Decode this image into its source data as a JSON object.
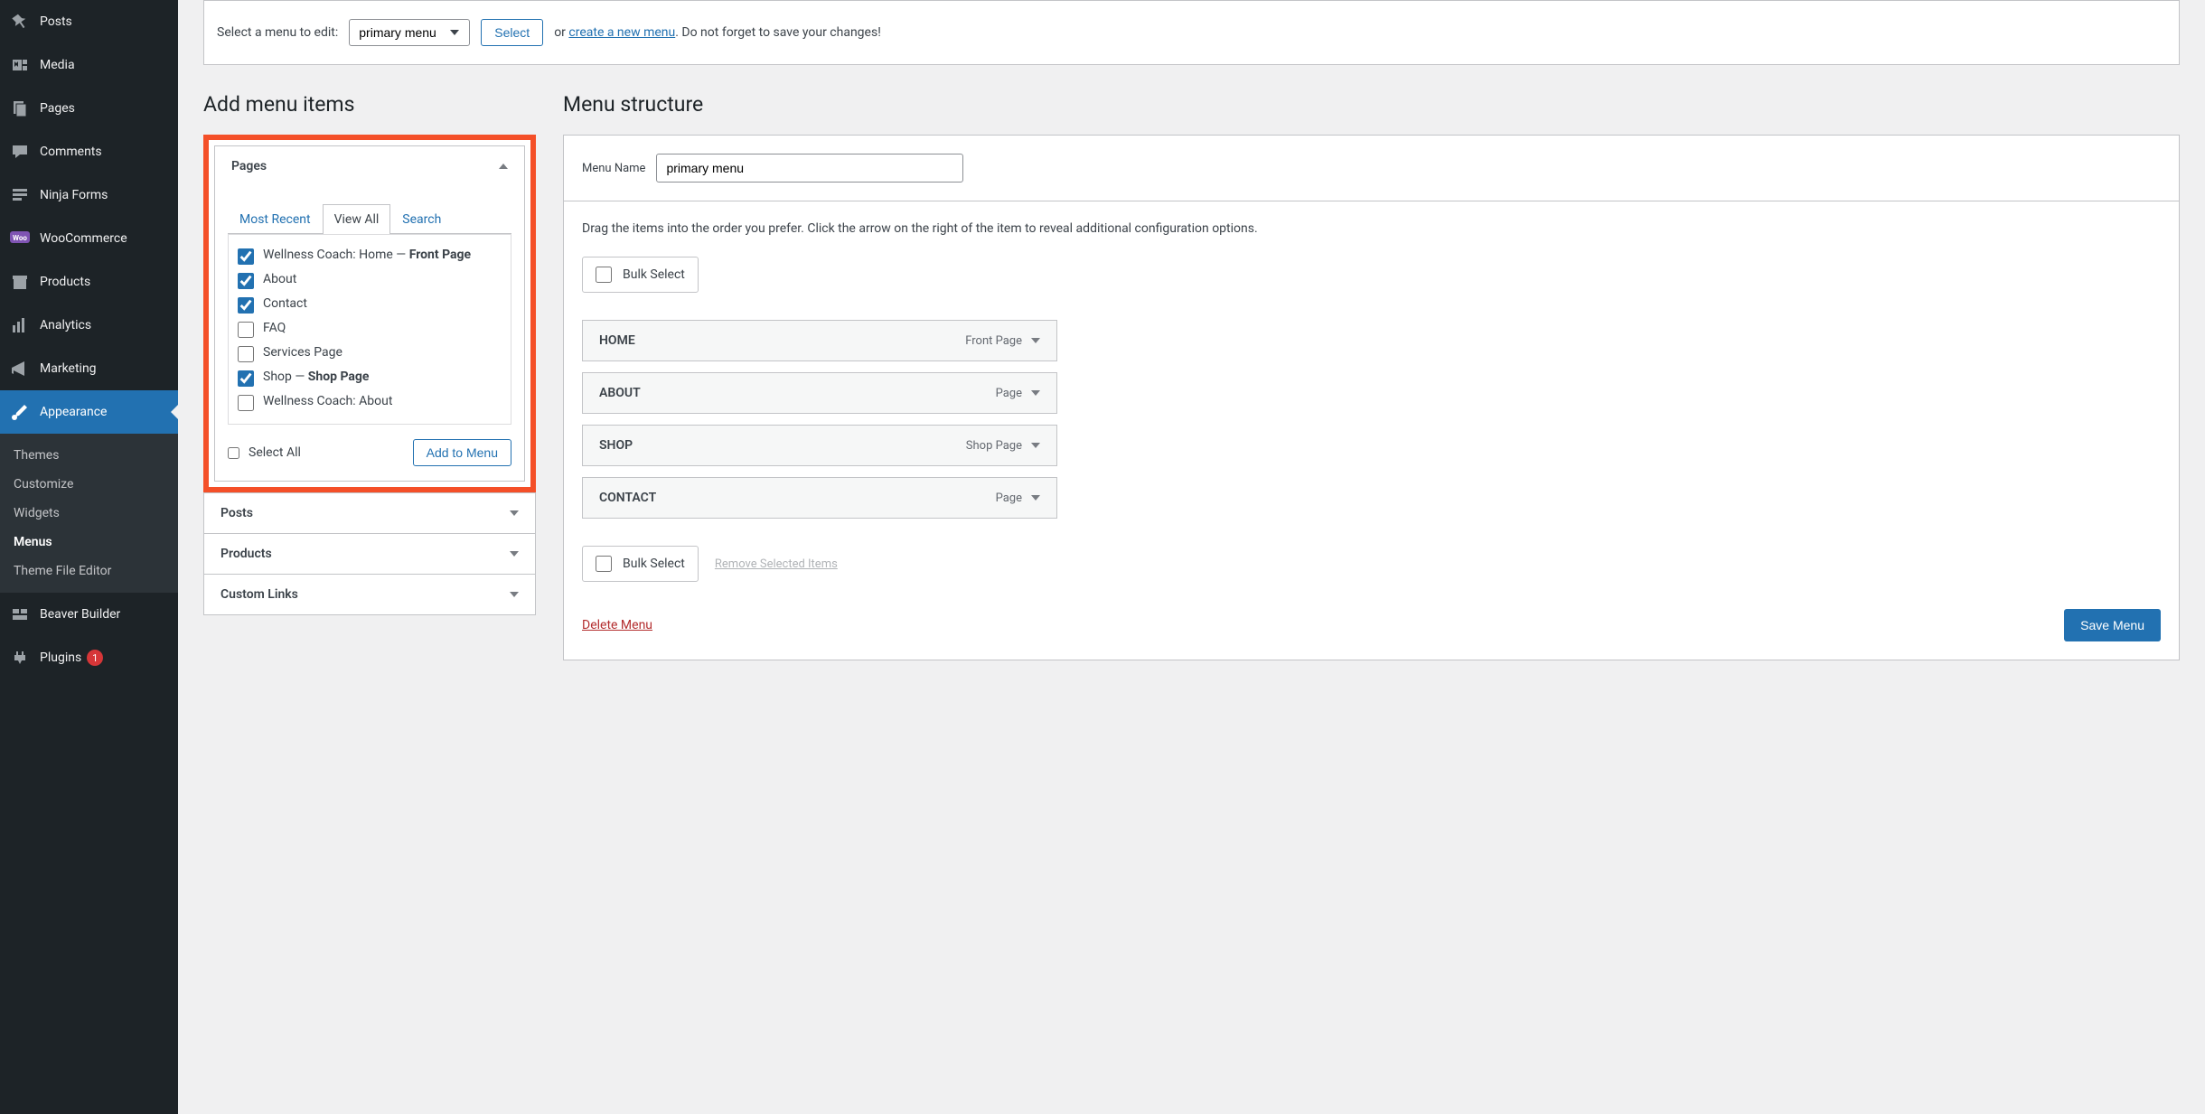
{
  "sidebar": {
    "items": [
      {
        "label": "Posts",
        "icon": "pin"
      },
      {
        "label": "Media",
        "icon": "media"
      },
      {
        "label": "Pages",
        "icon": "pages"
      },
      {
        "label": "Comments",
        "icon": "comment"
      },
      {
        "label": "Ninja Forms",
        "icon": "form"
      },
      {
        "label": "WooCommerce",
        "icon": "woo"
      },
      {
        "label": "Products",
        "icon": "products"
      },
      {
        "label": "Analytics",
        "icon": "analytics"
      },
      {
        "label": "Marketing",
        "icon": "marketing"
      },
      {
        "label": "Appearance",
        "icon": "brush"
      },
      {
        "label": "Beaver Builder",
        "icon": "beaver"
      },
      {
        "label": "Plugins",
        "icon": "plugin",
        "badge": "1"
      }
    ],
    "submenu": {
      "items": [
        {
          "label": "Themes"
        },
        {
          "label": "Customize"
        },
        {
          "label": "Widgets"
        },
        {
          "label": "Menus"
        },
        {
          "label": "Theme File Editor"
        }
      ],
      "current_index": 3
    }
  },
  "topbar": {
    "prompt": "Select a menu to edit:",
    "selected_menu": "primary menu",
    "select_btn": "Select",
    "or_text": "or ",
    "create_link": "create a new menu",
    "save_reminder": ". Do not forget to save your changes!"
  },
  "left": {
    "heading": "Add menu items",
    "accordion": {
      "expanded": "Pages",
      "tabs": [
        "Most Recent",
        "View All",
        "Search"
      ],
      "active_tab_index": 1,
      "pages": [
        {
          "checked": true,
          "label_prefix": "Wellness Coach: Home — ",
          "label_bold": "Front Page"
        },
        {
          "checked": true,
          "label_prefix": "About",
          "label_bold": ""
        },
        {
          "checked": true,
          "label_prefix": "Contact",
          "label_bold": ""
        },
        {
          "checked": false,
          "label_prefix": "FAQ",
          "label_bold": ""
        },
        {
          "checked": false,
          "label_prefix": "Services Page",
          "label_bold": ""
        },
        {
          "checked": true,
          "label_prefix": "Shop — ",
          "label_bold": "Shop Page"
        },
        {
          "checked": false,
          "label_prefix": "Wellness Coach: About",
          "label_bold": ""
        }
      ],
      "select_all": "Select All",
      "add_btn": "Add to Menu",
      "collapsed": [
        "Posts",
        "Products",
        "Custom Links"
      ]
    }
  },
  "right": {
    "heading": "Menu structure",
    "menu_name_label": "Menu Name",
    "menu_name_value": "primary menu",
    "desc": "Drag the items into the order you prefer. Click the arrow on the right of the item to reveal additional configuration options.",
    "bulk_select": "Bulk Select",
    "menu_items": [
      {
        "title": "HOME",
        "type": "Front Page"
      },
      {
        "title": "ABOUT",
        "type": "Page"
      },
      {
        "title": "SHOP",
        "type": "Shop Page"
      },
      {
        "title": "CONTACT",
        "type": "Page"
      }
    ],
    "remove_link": "Remove Selected Items",
    "delete_menu": "Delete Menu",
    "save_menu": "Save Menu"
  }
}
